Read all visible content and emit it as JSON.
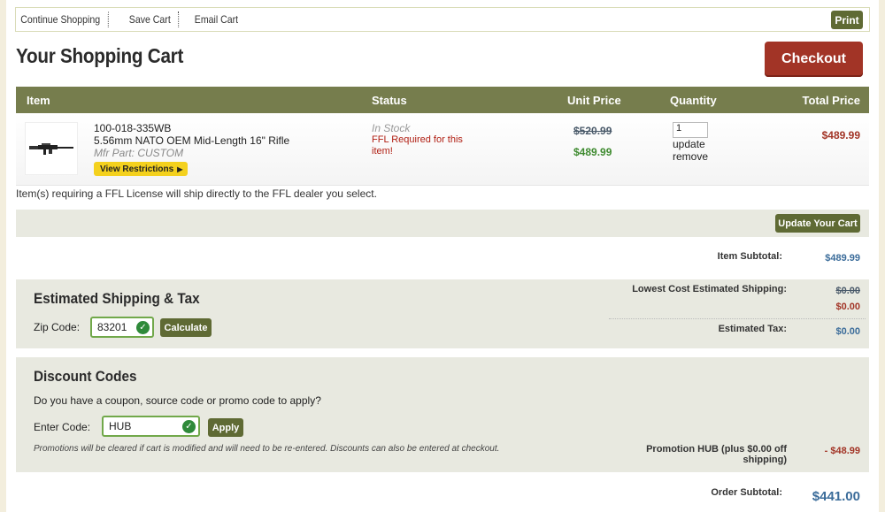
{
  "topbar": {
    "links": [
      "Continue Shopping",
      "Save Cart",
      "Email Cart"
    ],
    "print_label": "Print"
  },
  "page_title": "Your Shopping Cart",
  "checkout_label": "Checkout",
  "table": {
    "headers": [
      "Item",
      "Status",
      "Unit Price",
      "Quantity",
      "Total Price"
    ],
    "row": {
      "sku": "100-018-335WB",
      "name": "5.56mm NATO OEM Mid-Length 16\" Rifle",
      "mfr_part": "Mfr Part: CUSTOM",
      "restrictions_label": "View Restrictions",
      "status_stock": "In Stock",
      "status_ffl": "FFL Required for this item!",
      "old_price": "$520.99",
      "unit_price": "$489.99",
      "quantity": "1",
      "update_label": "update",
      "remove_label": "remove",
      "total_price": "$489.99"
    }
  },
  "ffl_note": "Item(s) requiring a FFL License will ship directly to the FFL dealer you select.",
  "update_cart_label": "Update Your Cart",
  "item_subtotal": {
    "label": "Item Subtotal:",
    "value": "$489.99"
  },
  "shipping": {
    "title": "Estimated Shipping & Tax",
    "zip_label": "Zip Code:",
    "zip_value": "83201",
    "calculate_label": "Calculate",
    "lowest_label": "Lowest Cost Estimated Shipping:",
    "lowest_old": "$0.00",
    "lowest_new": "$0.00",
    "tax_label": "Estimated Tax:",
    "tax_value": "$0.00"
  },
  "discount": {
    "title": "Discount Codes",
    "question": "Do you have a coupon, source code or promo code to apply?",
    "code_label": "Enter Code:",
    "code_value": "HUB",
    "apply_label": "Apply",
    "note": "Promotions will be cleared if cart is modified and will need to be re-entered. Discounts can also be entered at checkout.",
    "promo_label": "Promotion HUB (plus $0.00 off shipping)",
    "promo_value": "- $48.99"
  },
  "order_subtotal": {
    "label": "Order Subtotal:",
    "value": "$441.00"
  },
  "colors": {
    "header": "#767d4d",
    "checkout": "#a23426",
    "button": "#5f6a34",
    "panel": "#e8e9e0"
  }
}
